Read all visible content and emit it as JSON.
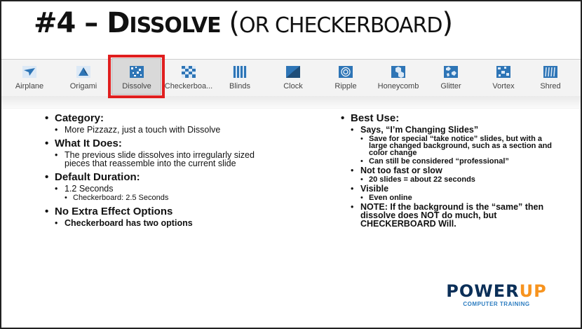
{
  "slide": {
    "title_prefix": "#4 – D",
    "title_word": "ISSOLVE",
    "title_paren_open": " (",
    "title_or": "OR C",
    "title_word2": "HECKERBOARD",
    "title_paren_close": ")"
  },
  "ribbon": {
    "transitions": [
      {
        "label": "Airplane",
        "icon": "airplane-icon"
      },
      {
        "label": "Origami",
        "icon": "origami-icon"
      },
      {
        "label": "Dissolve",
        "icon": "dissolve-icon",
        "selected": true
      },
      {
        "label": "Checkerboa...",
        "icon": "checkerboard-icon"
      },
      {
        "label": "Blinds",
        "icon": "blinds-icon"
      },
      {
        "label": "Clock",
        "icon": "clock-icon"
      },
      {
        "label": "Ripple",
        "icon": "ripple-icon"
      },
      {
        "label": "Honeycomb",
        "icon": "honeycomb-icon"
      },
      {
        "label": "Glitter",
        "icon": "glitter-icon"
      },
      {
        "label": "Vortex",
        "icon": "vortex-icon"
      },
      {
        "label": "Shred",
        "icon": "shred-icon"
      }
    ],
    "accent": "#2e75b6",
    "highlight": "#e01e1e"
  },
  "left": {
    "category_h": "Category:",
    "category_1": "More Pizzazz, just a touch with Dissolve",
    "what_h": "What It Does:",
    "what_1": "The previous slide dissolves into irregularly sized pieces that reassemble into the current slide",
    "duration_h": "Default Duration:",
    "duration_1": "1.2 Seconds",
    "duration_1a": "Checkerboard: 2.5 Seconds",
    "noeffect_h": "No Extra Effect Options",
    "noeffect_1": "Checkerboard has two options"
  },
  "right": {
    "best_h": "Best Use:",
    "best_1": "Says, “I’m Changing Slides”",
    "best_1a": "Save for special “take notice” slides, but with a large changed background, such as a section and color change",
    "best_1b": "Can still be considered “professional”",
    "best_2": "Not too fast or slow",
    "best_2a": "20 slides = about 22 seconds",
    "best_3": "Visible",
    "best_3a": "Even online",
    "best_4": "NOTE: If the background is the “same” then dissolve does NOT do much, but CHECKERBOARD Will."
  },
  "logo": {
    "power": "POWER",
    "up": "UP",
    "tagline": "COMPUTER TRAINING",
    "navy": "#0b2f58",
    "orange": "#f7931e",
    "blue": "#2b7cc0"
  }
}
